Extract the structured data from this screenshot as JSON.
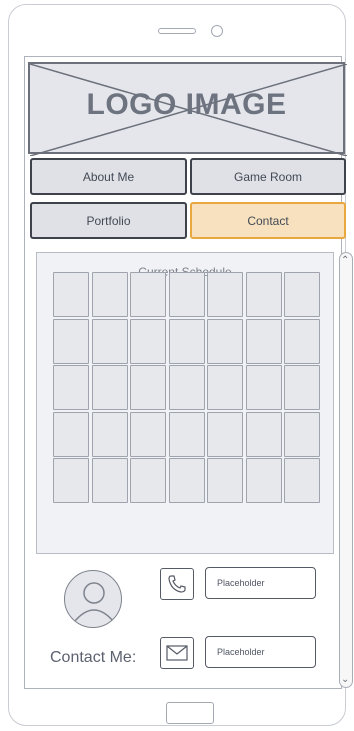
{
  "logo": {
    "text": "LOGO IMAGE"
  },
  "nav": {
    "about": "About Me",
    "game_room": "Game Room",
    "portfolio": "Portfolio",
    "contact": "Contact",
    "active": "contact"
  },
  "schedule": {
    "title": "Current Schedule",
    "rows": 5,
    "cols": 7
  },
  "contact": {
    "label": "Contact Me:",
    "phone_placeholder": "Placeholder",
    "email_placeholder": "Placeholder"
  },
  "icons": {
    "phone": "phone-icon",
    "mail": "mail-icon",
    "avatar": "user-avatar-icon"
  },
  "colors": {
    "active_bg": "#f7e1be",
    "active_border": "#e8a73f",
    "button_bg": "#dfe1e6"
  }
}
